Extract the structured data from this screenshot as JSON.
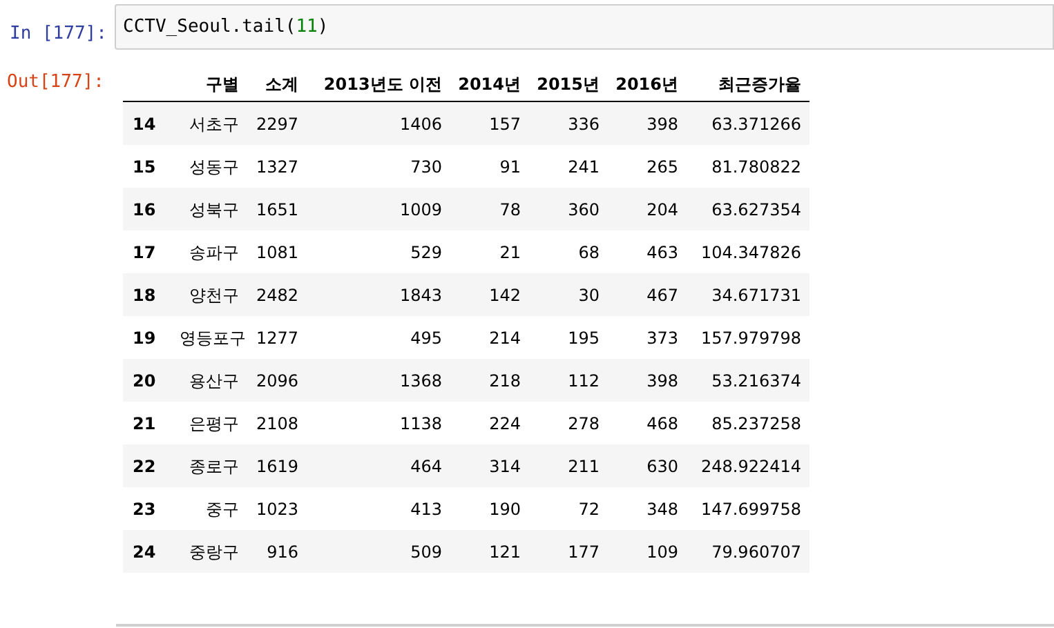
{
  "input_cell": {
    "prompt": "In [177]:",
    "code": [
      {
        "text": "CCTV_Seoul.tail(",
        "kind": "name"
      },
      {
        "text": "11",
        "kind": "number"
      },
      {
        "text": ")",
        "kind": "name"
      }
    ]
  },
  "output_cell": {
    "prompt": "Out[177]:",
    "table": {
      "columns": [
        "",
        "구별",
        "소계",
        "2013년도 이전",
        "2014년",
        "2015년",
        "2016년",
        "최근증가율"
      ],
      "rows": [
        [
          "14",
          "서초구",
          "2297",
          "1406",
          "157",
          "336",
          "398",
          "63.371266"
        ],
        [
          "15",
          "성동구",
          "1327",
          "730",
          "91",
          "241",
          "265",
          "81.780822"
        ],
        [
          "16",
          "성북구",
          "1651",
          "1009",
          "78",
          "360",
          "204",
          "63.627354"
        ],
        [
          "17",
          "송파구",
          "1081",
          "529",
          "21",
          "68",
          "463",
          "104.347826"
        ],
        [
          "18",
          "양천구",
          "2482",
          "1843",
          "142",
          "30",
          "467",
          "34.671731"
        ],
        [
          "19",
          "영등포구",
          "1277",
          "495",
          "214",
          "195",
          "373",
          "157.979798"
        ],
        [
          "20",
          "용산구",
          "2096",
          "1368",
          "218",
          "112",
          "398",
          "53.216374"
        ],
        [
          "21",
          "은평구",
          "2108",
          "1138",
          "224",
          "278",
          "468",
          "85.237258"
        ],
        [
          "22",
          "종로구",
          "1619",
          "464",
          "314",
          "211",
          "630",
          "248.922414"
        ],
        [
          "23",
          "중구",
          "1023",
          "413",
          "190",
          "72",
          "348",
          "147.699758"
        ],
        [
          "24",
          "중랑구",
          "916",
          "509",
          "121",
          "177",
          "109",
          "79.960707"
        ]
      ]
    }
  }
}
